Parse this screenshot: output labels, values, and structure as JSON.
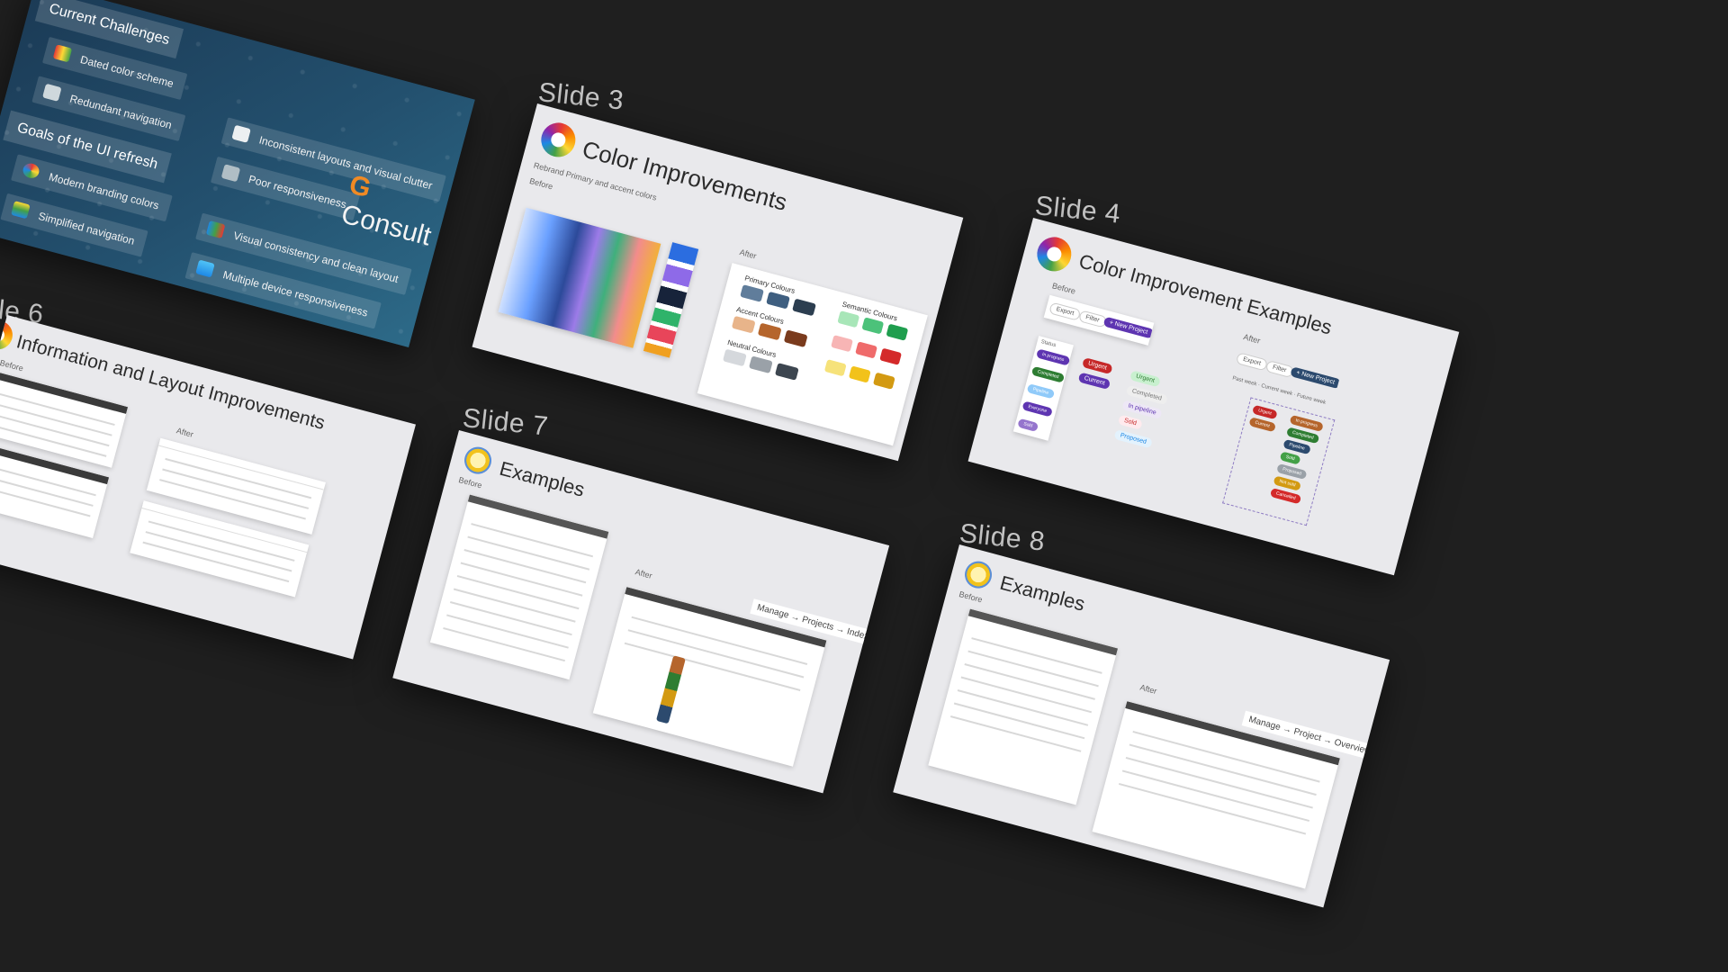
{
  "captions": {
    "slide3": "Slide 3",
    "slide4": "Slide 4",
    "slide6": "le 6",
    "slide7": "Slide 7",
    "slide8": "Slide 8"
  },
  "slide1": {
    "current_challenges": "Current Challenges",
    "challenges": [
      "Dated color scheme",
      "Redundant navigation",
      "Inconsistent layouts and visual clutter",
      "Poor responsiveness"
    ],
    "goals_title": "Goals of the UI refresh",
    "goals": [
      "Modern branding colors",
      "Simplified navigation",
      "Visual consistency and clean layout",
      "Multiple device responsiveness"
    ],
    "brand": "Consult"
  },
  "slide3": {
    "title": "Color Improvements",
    "subtitle": "Rebrand Primary and accent colors",
    "before": "Before",
    "after": "After",
    "primary": "Primary Colours",
    "accent": "Accent Colours",
    "neutral": "Neutral Colours",
    "semantic": "Semantic Colours"
  },
  "slide4": {
    "title": "Color Improvement Examples",
    "before": "Before",
    "after": "After",
    "export": "Export",
    "filter": "Filter",
    "new_project": "+ New Project",
    "status_label": "Status",
    "before_pills": [
      "In progress",
      "Completed",
      "Pipeline",
      "Everyone",
      "Sold"
    ],
    "mid_pills": [
      "Urgent",
      "Current"
    ],
    "mid_pills_2": [
      "In progress",
      "Completed",
      "In pipeline",
      "Sold",
      "Proposed"
    ],
    "after_left": [
      "Urgent",
      "Current"
    ],
    "after_right": [
      "In progress",
      "Completed",
      "Pipeline",
      "Sold",
      "Proposed",
      "Not sold",
      "Cancelled"
    ],
    "legend": [
      "Past week",
      "Current week",
      "Future week"
    ]
  },
  "slide6": {
    "title": "Information and Layout Improvements",
    "before": "Before",
    "after": "After"
  },
  "slide7": {
    "title": "Examples",
    "before": "Before",
    "after": "After",
    "breadcrumb": "Manage → Projects → Index"
  },
  "slide8": {
    "title": "Examples",
    "before": "Before",
    "after": "After",
    "breadcrumb": "Manage → Project → Overview"
  },
  "colors": {
    "background": "#1f1f1f",
    "slide": "#e9e9ec",
    "brand_orange": "#f08a24",
    "pill_purple": "#5e35b1",
    "pill_green": "#2e7d32",
    "pill_red": "#c62828"
  }
}
